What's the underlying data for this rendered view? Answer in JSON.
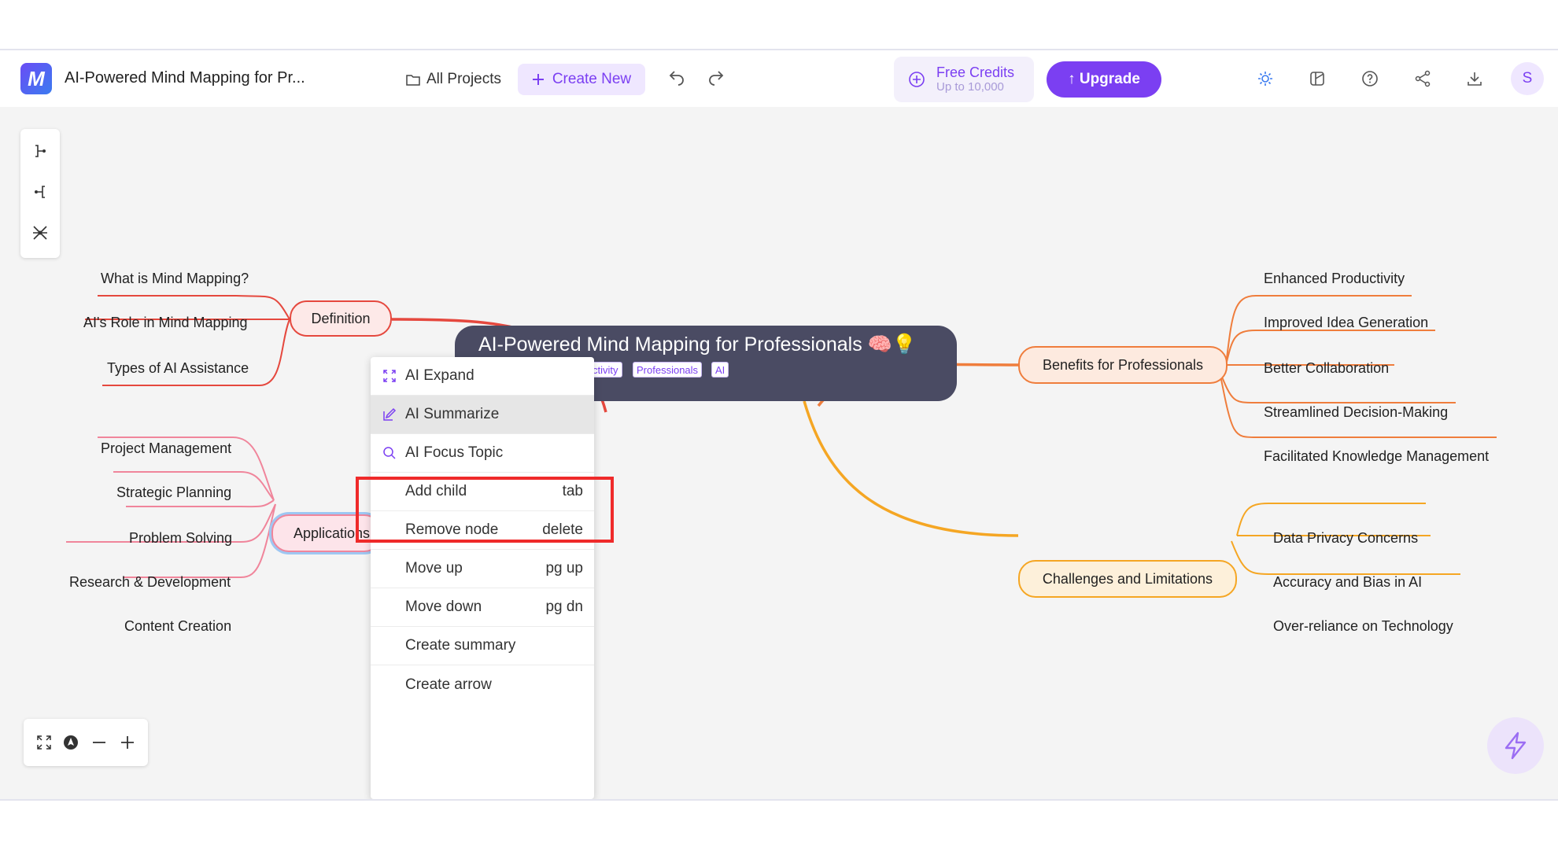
{
  "header": {
    "title": "AI-Powered Mind Mapping for Pr...",
    "logo_letter": "M",
    "all_projects": "All Projects",
    "create_new": "Create New",
    "credits_title": "Free Credits",
    "credits_sub": "Up to 10,000",
    "upgrade": "↑ Upgrade",
    "avatar": "S",
    "icons": [
      "sun-icon",
      "layout-icon",
      "help-icon",
      "share-icon",
      "download-icon"
    ]
  },
  "central": {
    "title": "AI-Powered Mind Mapping for Professionals 🧠💡",
    "tags": [
      "ctivity",
      "Professionals",
      "AI"
    ]
  },
  "branches": {
    "definition": {
      "label": "Definition",
      "color": "#e5483e",
      "children": [
        "What is Mind Mapping?",
        "AI's Role in Mind Mapping",
        "Types of AI Assistance"
      ]
    },
    "applications": {
      "label": "Applications",
      "color": "#f0859b",
      "children": [
        "Project Management",
        "Strategic Planning",
        "Problem Solving",
        "Research & Development",
        "Content Creation"
      ]
    },
    "benefits": {
      "label": "Benefits for Professionals",
      "color": "#ef7d3c",
      "children": [
        "Enhanced Productivity",
        "Improved Idea Generation",
        "Better Collaboration",
        "Streamlined Decision-Making",
        "Facilitated Knowledge Management"
      ]
    },
    "challenges": {
      "label": "Challenges and Limitations",
      "color": "#f5a623",
      "children": [
        "Data Privacy Concerns",
        "Accuracy and Bias in AI",
        "Over-reliance on Technology"
      ]
    }
  },
  "context_menu": {
    "items": [
      {
        "label": "AI Expand",
        "key": ""
      },
      {
        "label": "AI Summarize",
        "key": ""
      },
      {
        "label": "AI Focus Topic",
        "key": ""
      },
      {
        "label": "Add child",
        "key": "tab"
      },
      {
        "label": "Remove node",
        "key": "delete"
      },
      {
        "label": "Move up",
        "key": "pg up"
      },
      {
        "label": "Move down",
        "key": "pg dn"
      },
      {
        "label": "Create summary",
        "key": ""
      },
      {
        "label": "Create arrow",
        "key": ""
      }
    ],
    "selected": "AI Summarize"
  },
  "colors": {
    "accent": "#7b3ff2",
    "highlight": "#ef2a2a",
    "central_bg": "#4a4b63"
  }
}
